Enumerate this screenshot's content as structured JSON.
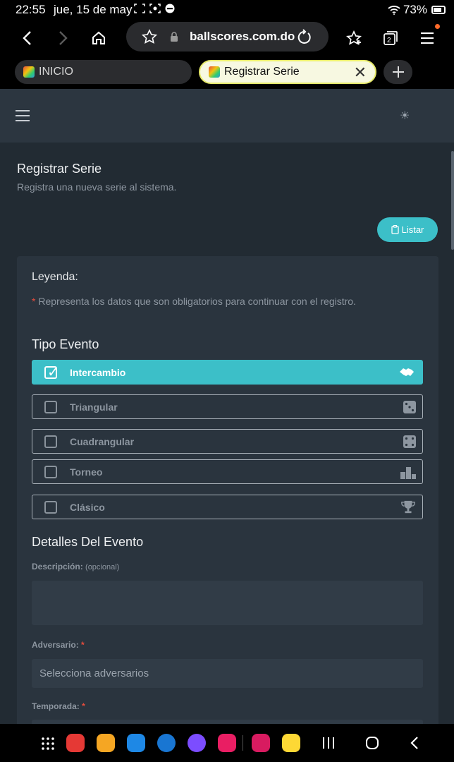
{
  "status": {
    "time": "22:55",
    "date": "jue, 15 de may",
    "battery": "73%"
  },
  "browser": {
    "url": "ballscores.com.do",
    "tabs": [
      {
        "label": "INICIO",
        "active": false
      },
      {
        "label": "Registrar Serie",
        "active": true
      }
    ]
  },
  "page": {
    "title": "Registrar Serie",
    "subtitle": "Registra una nueva serie al sistema.",
    "listar_button": "Listar",
    "legend": {
      "title": "Leyenda:",
      "star": "*",
      "text": "Representa los datos que son obligatorios para continuar con el registro."
    },
    "tipo_evento": {
      "title": "Tipo Evento",
      "options": [
        {
          "label": "Intercambio",
          "checked": true,
          "icon": "handshake-icon"
        },
        {
          "label": "Triangular",
          "checked": false,
          "icon": "dice-three-icon"
        },
        {
          "label": "Cuadrangular",
          "checked": false,
          "icon": "dice-four-icon"
        },
        {
          "label": "Torneo",
          "checked": false,
          "icon": "podium-icon"
        },
        {
          "label": "Clásico",
          "checked": false,
          "icon": "trophy-icon"
        }
      ]
    },
    "detalles": {
      "title": "Detalles Del Evento",
      "descripcion_label": "Descripción:",
      "descripcion_optional": "(opcional)",
      "adversario_label": "Adversario:",
      "adversario_placeholder": "Selecciona adversarios",
      "temporada_label": "Temporada:",
      "required_mark": "*"
    }
  },
  "colors": {
    "accent": "#3cbfc8",
    "background": "#222b33",
    "card": "#2a343e",
    "required": "#e74c3c"
  }
}
